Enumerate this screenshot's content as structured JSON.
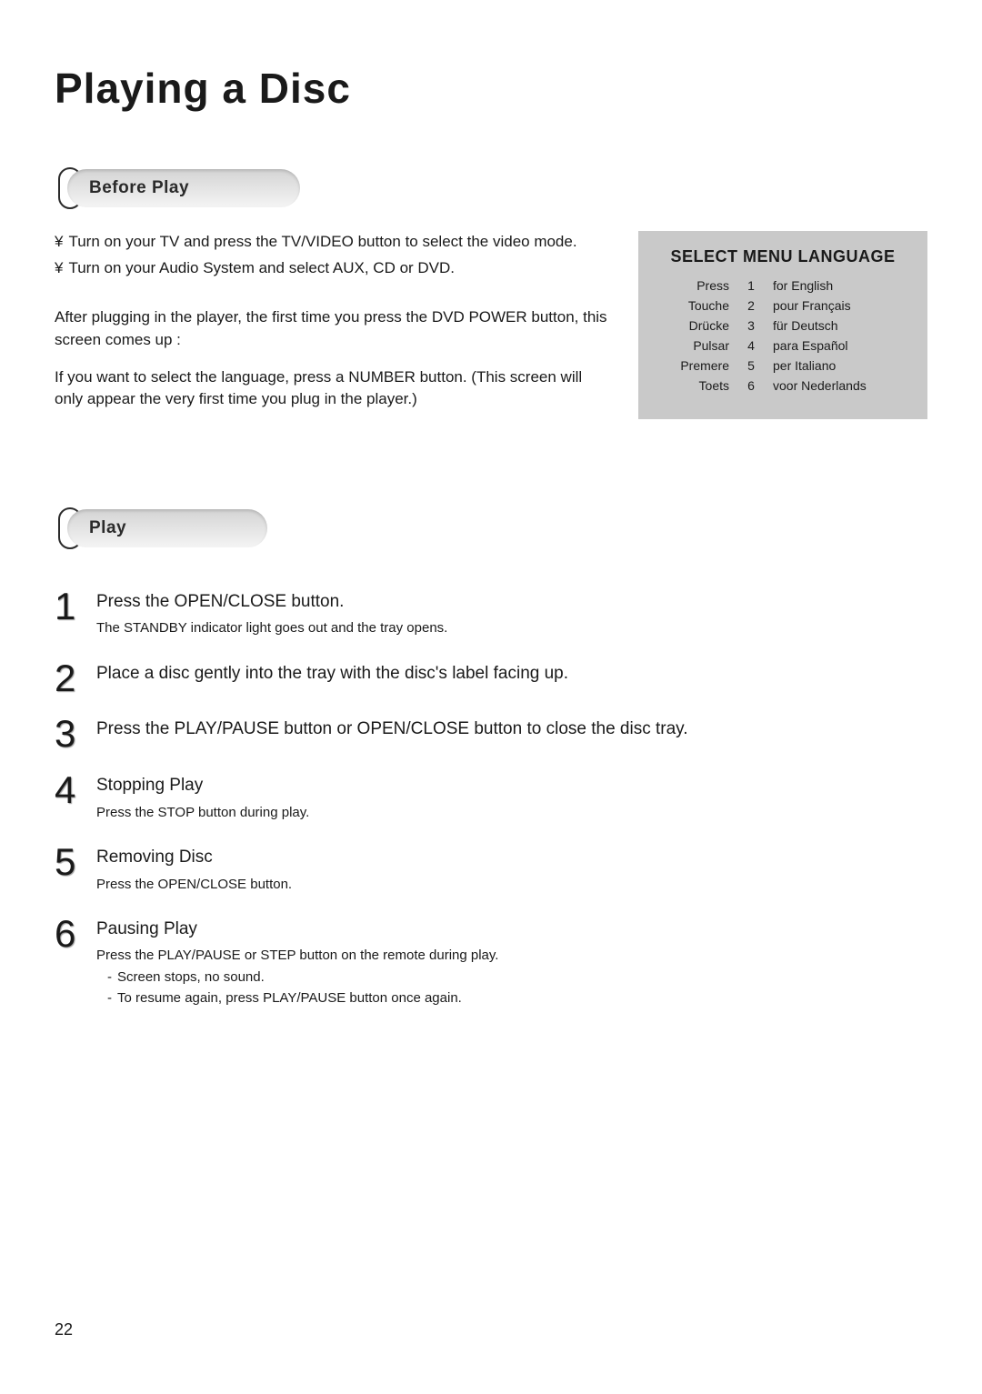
{
  "title": "Playing a Disc",
  "sections": {
    "before_play_label": "Before Play",
    "play_label": "Play"
  },
  "before_play": {
    "bullets": [
      "Turn on your TV and press the TV/VIDEO button to select the video mode.",
      "Turn on your Audio System and select AUX, CD or DVD."
    ],
    "para1": "After plugging in the player, the first time you press the DVD POWER button, this screen comes up :",
    "para2": "If you want to select the language, press a NUMBER button. (This screen will only appear the very first time you plug in the player.)"
  },
  "lang_menu": {
    "title": "SELECT MENU LANGUAGE",
    "rows": [
      {
        "press": "Press",
        "num": "1",
        "text": "for English"
      },
      {
        "press": "Touche",
        "num": "2",
        "text": "pour Français"
      },
      {
        "press": "Drücke",
        "num": "3",
        "text": "für Deutsch"
      },
      {
        "press": "Pulsar",
        "num": "4",
        "text": "para Español"
      },
      {
        "press": "Premere",
        "num": "5",
        "text": "per Italiano"
      },
      {
        "press": "Toets",
        "num": "6",
        "text": "voor  Nederlands"
      }
    ]
  },
  "steps": [
    {
      "num": "1",
      "main": "Press the OPEN/CLOSE button.",
      "sub": [
        "The STANDBY indicator light goes out and the tray opens."
      ]
    },
    {
      "num": "2",
      "main": "Place a disc gently into the tray with the disc's label facing up.",
      "sub": []
    },
    {
      "num": "3",
      "main": "Press the PLAY/PAUSE button or OPEN/CLOSE button to close the disc tray.",
      "sub": []
    },
    {
      "num": "4",
      "main": "Stopping Play",
      "sub": [
        "Press the STOP button during play."
      ]
    },
    {
      "num": "5",
      "main": "Removing Disc",
      "sub": [
        "Press the OPEN/CLOSE button."
      ]
    },
    {
      "num": "6",
      "main": "Pausing Play",
      "sub": [
        "Press the PLAY/PAUSE or STEP button on the remote during play."
      ],
      "dash": [
        "Screen stops, no sound.",
        "To resume again, press PLAY/PAUSE button once again."
      ]
    }
  ],
  "page_number": "22",
  "bullet_glyph": "¥"
}
